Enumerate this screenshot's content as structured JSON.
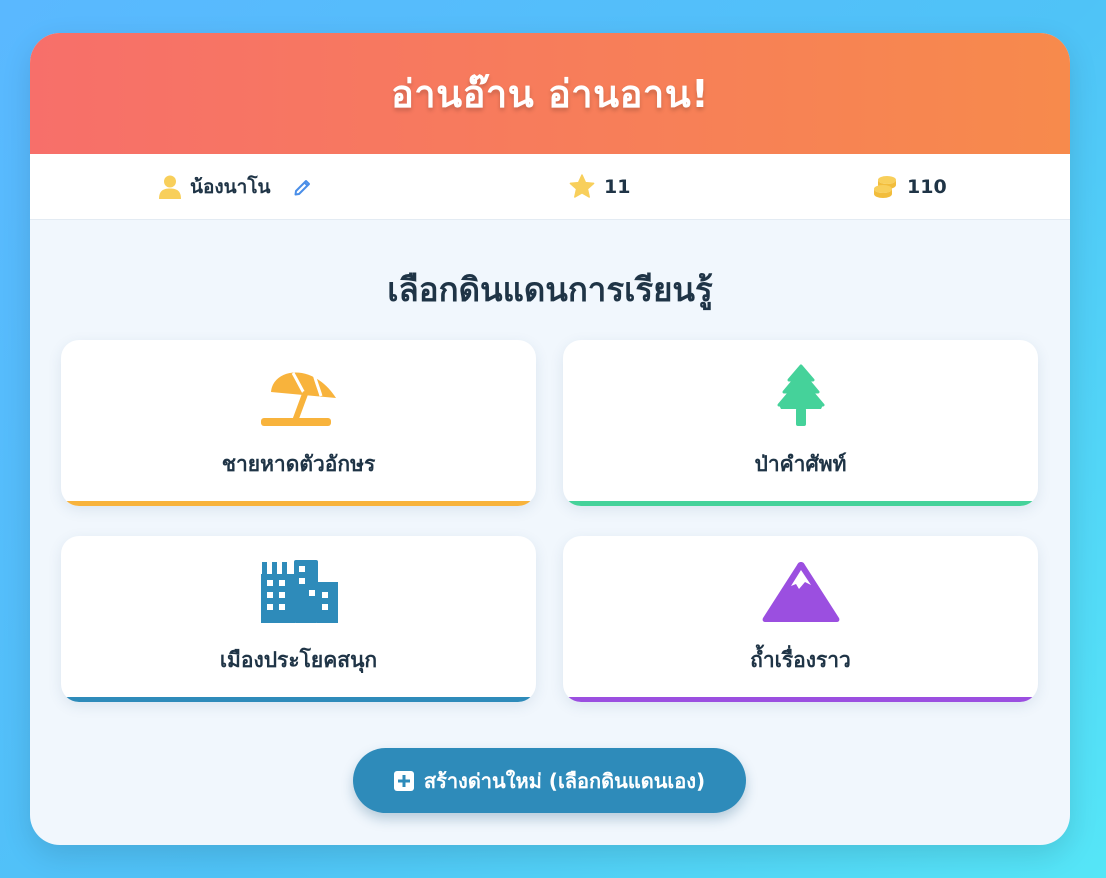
{
  "app": {
    "title": "อ่านอ๊าน อ่านอาน!"
  },
  "status": {
    "player_name": "น้องนาโน",
    "stars": "11",
    "coins": "110"
  },
  "main": {
    "section_title": "เลือกดินแดนการเรียนรู้",
    "lands": [
      {
        "label": "ชายหาดตัวอักษร",
        "icon": "beach-umbrella-icon",
        "accent": "#f8b33c"
      },
      {
        "label": "ป่าคำศัพท์",
        "icon": "tree-icon",
        "accent": "#45d29a"
      },
      {
        "label": "เมืองประโยคสนุก",
        "icon": "city-icon",
        "accent": "#2e8bba"
      },
      {
        "label": "ถ้ำเรื่องราว",
        "icon": "mountain-icon",
        "accent": "#9b4fe0"
      }
    ],
    "create_button": "สร้างด่านใหม่ (เลือกดินแดนเอง)"
  },
  "colors": {
    "header_start": "#f76f6a",
    "header_end": "#f78a4c",
    "icon_yellow": "#f8cf5b",
    "button": "#2e8bba"
  }
}
